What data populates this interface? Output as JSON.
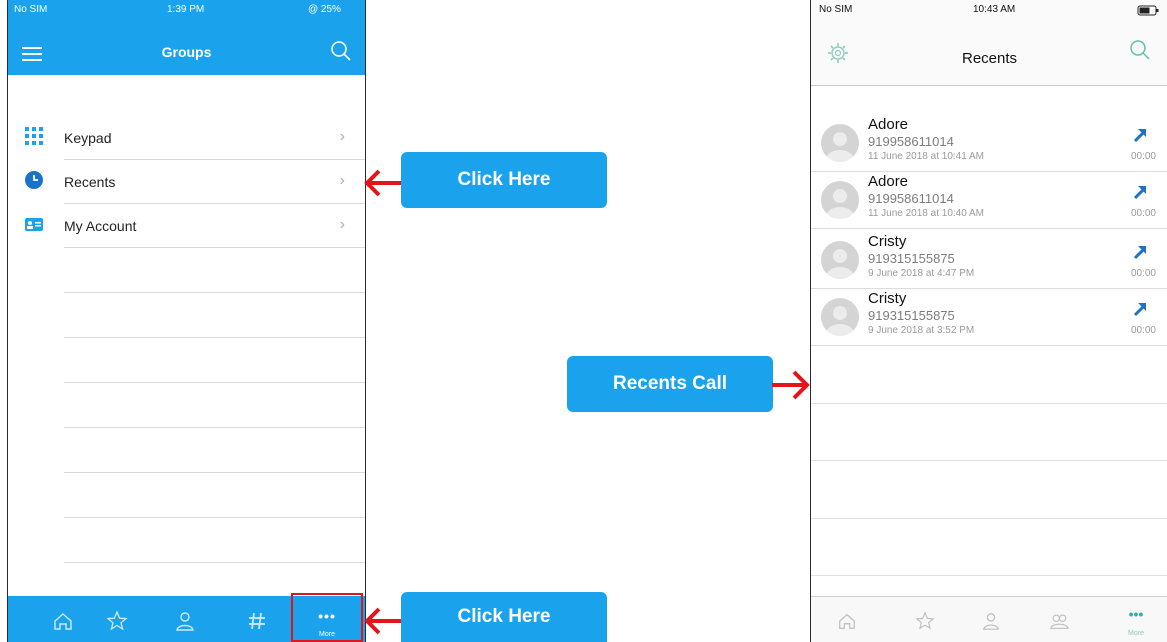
{
  "left_phone": {
    "status": {
      "carrier": "No SIM",
      "time": "1:39 PM",
      "battery": "@ 25%"
    },
    "title": "Groups",
    "menu_items": [
      {
        "label": "Keypad",
        "icon": "keypad-icon"
      },
      {
        "label": "Recents",
        "icon": "clock-icon"
      },
      {
        "label": "My Account",
        "icon": "account-card-icon"
      }
    ],
    "tabbar": {
      "items": [
        "home-icon",
        "star-icon",
        "person-icon",
        "hash-icon",
        "more-icon"
      ],
      "more_label": "More",
      "more_dots": "•••"
    }
  },
  "callouts": [
    {
      "label": "Click Here",
      "target": "Recents"
    },
    {
      "label": "Click Here",
      "target": "More"
    },
    {
      "label": "Recents Call",
      "target": "Recents list"
    }
  ],
  "right_phone": {
    "status": {
      "carrier": "No SIM",
      "time": "10:43 AM"
    },
    "title": "Recents",
    "recents": [
      {
        "name": "Adore",
        "number": "919958611014",
        "timestamp": "11 June 2018 at 10:41 AM",
        "duration": "00:00"
      },
      {
        "name": "Adore",
        "number": "919958611014",
        "timestamp": "11 June 2018 at 10:40 AM",
        "duration": "00:00"
      },
      {
        "name": "Cristy",
        "number": "919315155875",
        "timestamp": "9 June 2018 at 4:47 PM",
        "duration": "00:00"
      },
      {
        "name": "Cristy",
        "number": "919315155875",
        "timestamp": "9 June 2018 at 3:52 PM",
        "duration": "00:00"
      }
    ],
    "tabbar": {
      "items": [
        "home-icon",
        "star-icon",
        "person-icon",
        "group-icon",
        "more-icon"
      ],
      "more_label": "More",
      "more_dots": "•••"
    }
  },
  "colors": {
    "brand_blue": "#1aa3ec",
    "highlight_red": "#e3151a",
    "accent_teal": "#2fb39a",
    "call_arrow": "#1a73c9"
  }
}
